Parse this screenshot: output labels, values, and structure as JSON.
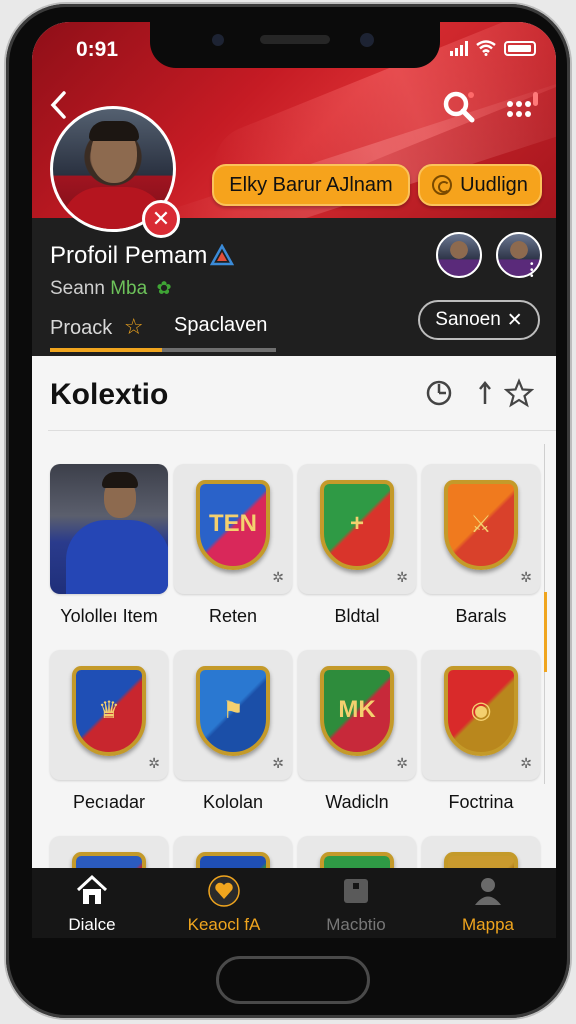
{
  "status_bar": {
    "time": "0:91"
  },
  "header": {
    "pill_primary": "Elky Barur AJlnam",
    "pill_secondary": "Uudlign"
  },
  "profile": {
    "name": "Profoil Pemam",
    "subtitle_prefix": "Seann",
    "subtitle_highlight": "Mba",
    "tabs": [
      {
        "label": "Proack"
      },
      {
        "label": "Spaclaven"
      }
    ],
    "action_button": "Sanoen"
  },
  "collection": {
    "title": "Kolextio",
    "items": [
      {
        "label": "Yololleı Item",
        "kind": "photo"
      },
      {
        "label": "Reten",
        "kind": "crest",
        "colors": [
          "#2a62c9",
          "#d9285a"
        ],
        "mark": "TEN"
      },
      {
        "label": "Bldtal",
        "kind": "crest",
        "colors": [
          "#2f9a45",
          "#d9342b"
        ],
        "mark": "+"
      },
      {
        "label": "Barals",
        "kind": "crest",
        "colors": [
          "#f07a1e",
          "#d9412b"
        ],
        "mark": "⚔"
      },
      {
        "label": "Pecıadar",
        "kind": "crest",
        "colors": [
          "#1f4fb5",
          "#c8262e"
        ],
        "mark": "♛"
      },
      {
        "label": "Kololan",
        "kind": "crest",
        "colors": [
          "#2a78d1",
          "#1b4fa8"
        ],
        "mark": "⚑"
      },
      {
        "label": "Wadicln",
        "kind": "crest",
        "colors": [
          "#2e8c3c",
          "#c7293a"
        ],
        "mark": "MK"
      },
      {
        "label": "Foctrina",
        "kind": "crest",
        "colors": [
          "#d92a2a",
          "#b9871d"
        ],
        "mark": "◉"
      },
      {
        "label": "",
        "kind": "crest",
        "colors": [
          "#2b5bbf",
          "#c8262e"
        ],
        "mark": ""
      },
      {
        "label": "",
        "kind": "crest",
        "colors": [
          "#1f4fb5",
          "#2e8c3c"
        ],
        "mark": ""
      },
      {
        "label": "",
        "kind": "crest",
        "colors": [
          "#2f9a45",
          "#2f9a45"
        ],
        "mark": ""
      },
      {
        "label": "",
        "kind": "crest",
        "colors": [
          "#c99a2e",
          "#b37d1a"
        ],
        "mark": ""
      }
    ]
  },
  "bottom_nav": [
    {
      "label": "Dialce",
      "icon": "home-icon",
      "color": "#ffffff"
    },
    {
      "label": "Keaocl fA",
      "icon": "heart-icon",
      "color": "#f0a51e"
    },
    {
      "label": "Macbtio",
      "icon": "box-icon",
      "color": "#777777"
    },
    {
      "label": "Mappa",
      "icon": "person-icon",
      "color": "#f0a51e"
    }
  ],
  "theme": {
    "accent": "#f0a51e",
    "brand_red": "#c51b24"
  }
}
